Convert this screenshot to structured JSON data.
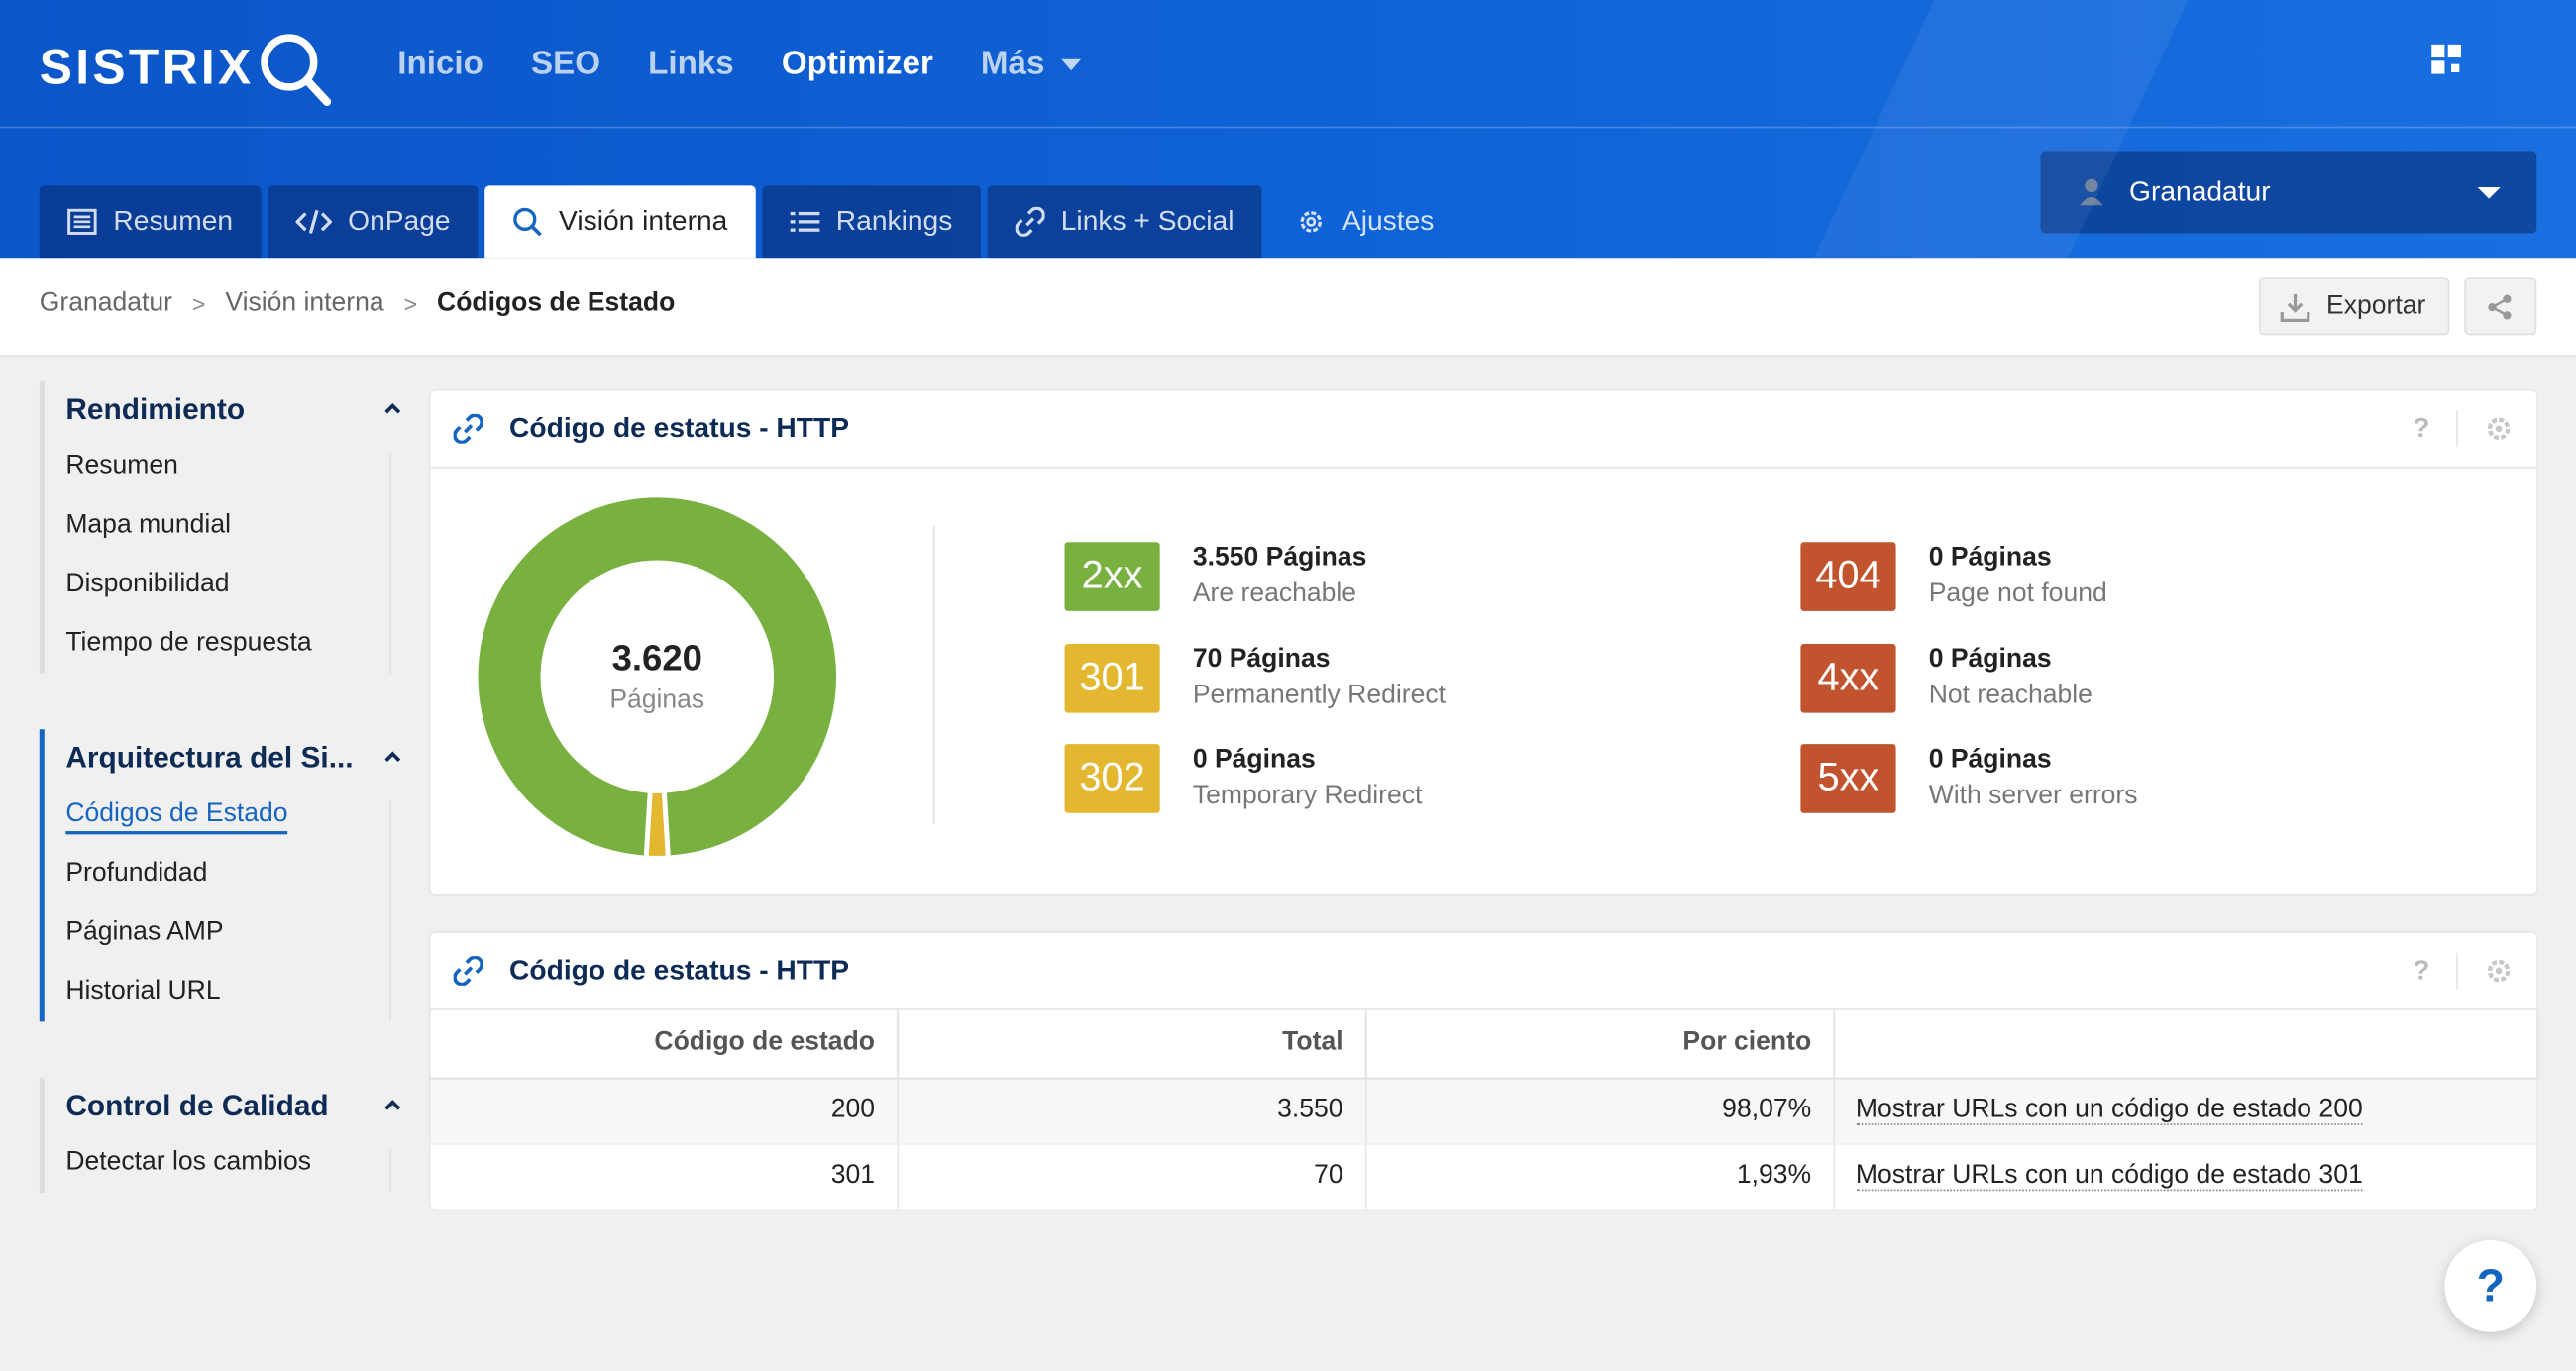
{
  "app": {
    "logo": "SISTRIX"
  },
  "nav": {
    "items": [
      "Inicio",
      "SEO",
      "Links",
      "Optimizer",
      "Más"
    ],
    "active": "Optimizer"
  },
  "tabs": [
    {
      "label": "Resumen",
      "icon": "list-icon"
    },
    {
      "label": "OnPage",
      "icon": "code-icon"
    },
    {
      "label": "Visión interna",
      "icon": "search-icon"
    },
    {
      "label": "Rankings",
      "icon": "bullet-list-icon"
    },
    {
      "label": "Links + Social",
      "icon": "link-icon"
    },
    {
      "label": "Ajustes",
      "icon": "gear-icon"
    }
  ],
  "project": {
    "name": "Granadatur"
  },
  "breadcrumb": {
    "items": [
      "Granadatur",
      "Visión interna",
      "Códigos de Estado"
    ]
  },
  "actions": {
    "export": "Exportar"
  },
  "sidebar": {
    "groups": [
      {
        "title": "Rendimiento",
        "items": [
          "Resumen",
          "Mapa mundial",
          "Disponibilidad",
          "Tiempo de respuesta"
        ]
      },
      {
        "title": "Arquitectura del Si...",
        "items": [
          "Códigos de Estado",
          "Profundidad",
          "Páginas AMP",
          "Historial URL"
        ]
      },
      {
        "title": "Control de Calidad",
        "items": [
          "Detectar los cambios"
        ]
      }
    ],
    "active_item": "Códigos de Estado"
  },
  "panel1": {
    "title": "Código de estatus - HTTP",
    "help": "?",
    "total": "3.620",
    "total_label": "Páginas",
    "stats": [
      {
        "code": "2xx",
        "pages": "3.550 Páginas",
        "desc": "Are reachable",
        "color": "#79b140"
      },
      {
        "code": "301",
        "pages": "70 Páginas",
        "desc": "Permanently Redirect",
        "color": "#e3b72f"
      },
      {
        "code": "302",
        "pages": "0 Páginas",
        "desc": "Temporary Redirect",
        "color": "#e3b72f"
      },
      {
        "code": "404",
        "pages": "0 Páginas",
        "desc": "Page not found",
        "color": "#c1532f"
      },
      {
        "code": "4xx",
        "pages": "0 Páginas",
        "desc": "Not reachable",
        "color": "#c1532f"
      },
      {
        "code": "5xx",
        "pages": "0 Páginas",
        "desc": "With server errors",
        "color": "#c1532f"
      }
    ],
    "donut": {
      "values": [
        3550,
        70
      ],
      "colors": [
        "#79b140",
        "#e3b72f"
      ]
    }
  },
  "panel2": {
    "title": "Código de estatus - HTTP",
    "help": "?",
    "columns": [
      "Código de estado",
      "Total",
      "Por ciento",
      ""
    ],
    "rows": [
      [
        "200",
        "3.550",
        "98,07%",
        "Mostrar URLs con un código de estado 200"
      ],
      [
        "301",
        "70",
        "1,93%",
        "Mostrar URLs con un código de estado 301"
      ]
    ]
  },
  "help_button": "?"
}
